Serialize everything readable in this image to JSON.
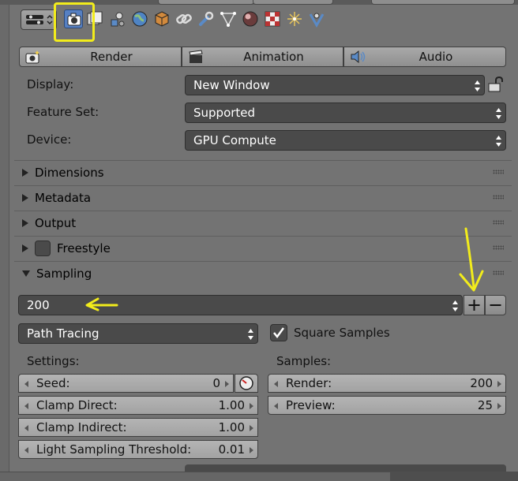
{
  "tabs": [
    {
      "id": "render",
      "icon": "camera-icon"
    },
    {
      "id": "render-layers",
      "icon": "render-layers-icon"
    },
    {
      "id": "scene",
      "icon": "scene-icon"
    },
    {
      "id": "world",
      "icon": "world-icon"
    },
    {
      "id": "object",
      "icon": "cube-icon"
    },
    {
      "id": "constraints",
      "icon": "chain-link-icon"
    },
    {
      "id": "modifiers",
      "icon": "wrench-icon"
    },
    {
      "id": "data",
      "icon": "mesh-data-icon"
    },
    {
      "id": "material",
      "icon": "material-sphere-icon"
    },
    {
      "id": "texture",
      "icon": "checker-texture-icon"
    },
    {
      "id": "particles",
      "icon": "particles-icon"
    },
    {
      "id": "physics",
      "icon": "physics-icon"
    }
  ],
  "render_row": {
    "render_label": "Render",
    "animation_label": "Animation",
    "audio_label": "Audio"
  },
  "settings": {
    "display_label": "Display:",
    "display_value": "New Window",
    "feature_set_label": "Feature Set:",
    "feature_set_value": "Supported",
    "device_label": "Device:",
    "device_value": "GPU Compute"
  },
  "panels": {
    "dimensions": "Dimensions",
    "metadata": "Metadata",
    "output": "Output",
    "freestyle": "Freestyle",
    "sampling": "Sampling"
  },
  "sampling": {
    "preset_value": "200",
    "integrator_value": "Path Tracing",
    "square_samples_label": "Square Samples",
    "square_samples_checked": true,
    "settings_label": "Settings:",
    "samples_label": "Samples:",
    "seed_label": "Seed:",
    "seed_value": "0",
    "clamp_direct_label": "Clamp Direct:",
    "clamp_direct_value": "1.00",
    "clamp_indirect_label": "Clamp Indirect:",
    "clamp_indirect_value": "1.00",
    "light_threshold_label": "Light Sampling Threshold:",
    "light_threshold_value": "0.01",
    "render_samples_label": "Render:",
    "render_samples_value": "200",
    "preview_samples_label": "Preview:",
    "preview_samples_value": "25"
  },
  "colors": {
    "background": "#737373",
    "annotation": "#f2ec1b",
    "active_tab": "#5680c2"
  }
}
